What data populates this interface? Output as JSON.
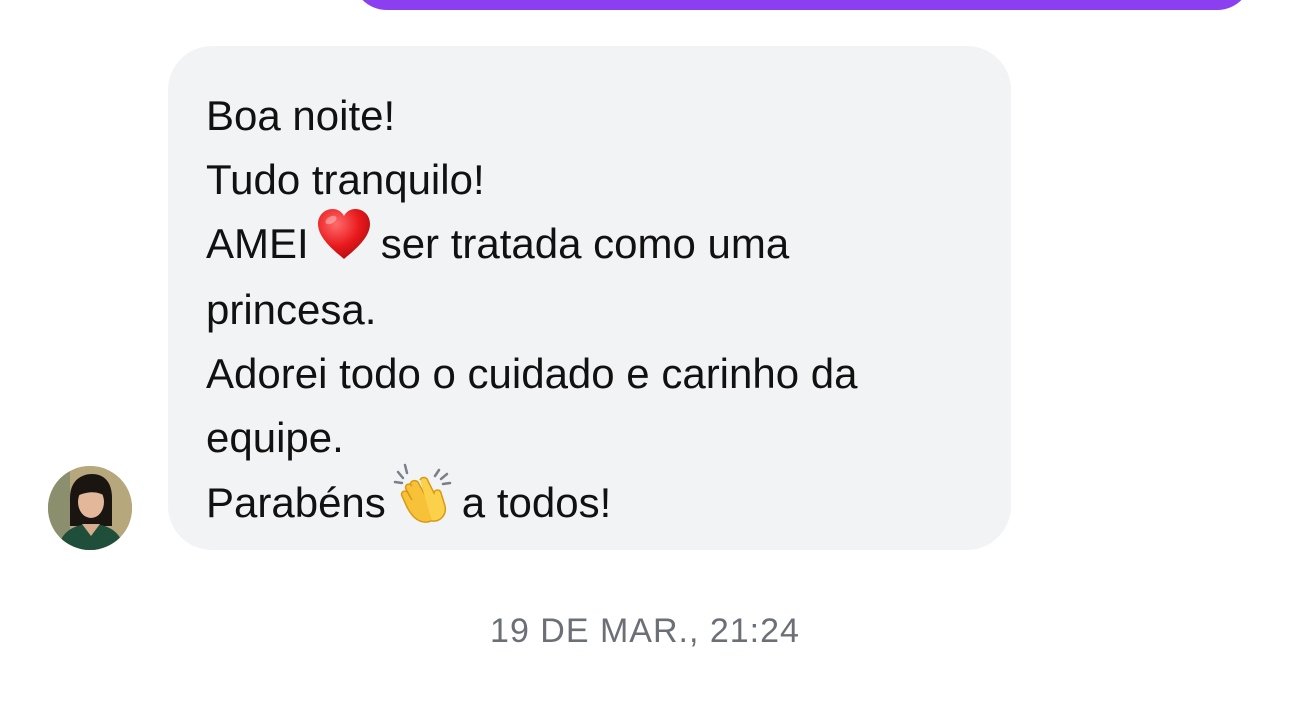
{
  "conversation": {
    "received_message": {
      "lines": [
        "Boa noite!",
        "Tudo tranquilo!",
        "AMEI",
        "ser tratada como uma",
        "princesa.",
        "Adorei todo o cuidado e carinho da",
        "equipe.",
        "Parabéns",
        "a todos!"
      ],
      "icons": {
        "heart": "red-heart-icon",
        "clap": "clapping-hands-icon"
      }
    },
    "timestamp": "19 DE MAR., 21:24"
  },
  "colors": {
    "sent_bubble": "#8c3ff0",
    "received_bubble": "#f2f3f5",
    "timestamp_text": "#6b6f76"
  }
}
